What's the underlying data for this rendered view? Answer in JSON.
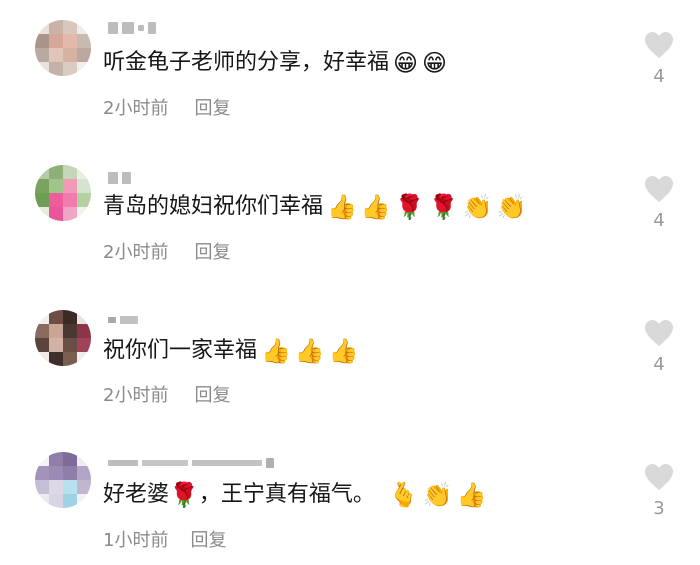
{
  "comments": [
    {
      "text": "听金龟子老师的分享，好幸福",
      "emojis": [
        "😁",
        "😁"
      ],
      "time": "2小时前",
      "reply": "回复",
      "likes": "4"
    },
    {
      "text": "青岛的媳妇祝你们幸福",
      "emojis": [
        "👍",
        "👍",
        "🌹",
        "🌹",
        "👏",
        "👏"
      ],
      "time": "2小时前",
      "reply": "回复",
      "likes": "4"
    },
    {
      "text": "祝你们一家幸福",
      "emojis": [
        "👍",
        "👍",
        "👍"
      ],
      "time": "2小时前",
      "reply": "回复",
      "likes": "4"
    },
    {
      "text_before": "好老婆",
      "text_emoji": "🌹",
      "text_after": "，王宁真有福气。",
      "emojis": [
        "🫰",
        "👏",
        "👍"
      ],
      "time": "1小时前",
      "reply": "回复",
      "likes": "3"
    }
  ],
  "icons": {
    "like": "heart-icon"
  },
  "colors": {
    "text": "#161616",
    "meta": "#8a8a8a",
    "heart": "#d9d9d9"
  }
}
